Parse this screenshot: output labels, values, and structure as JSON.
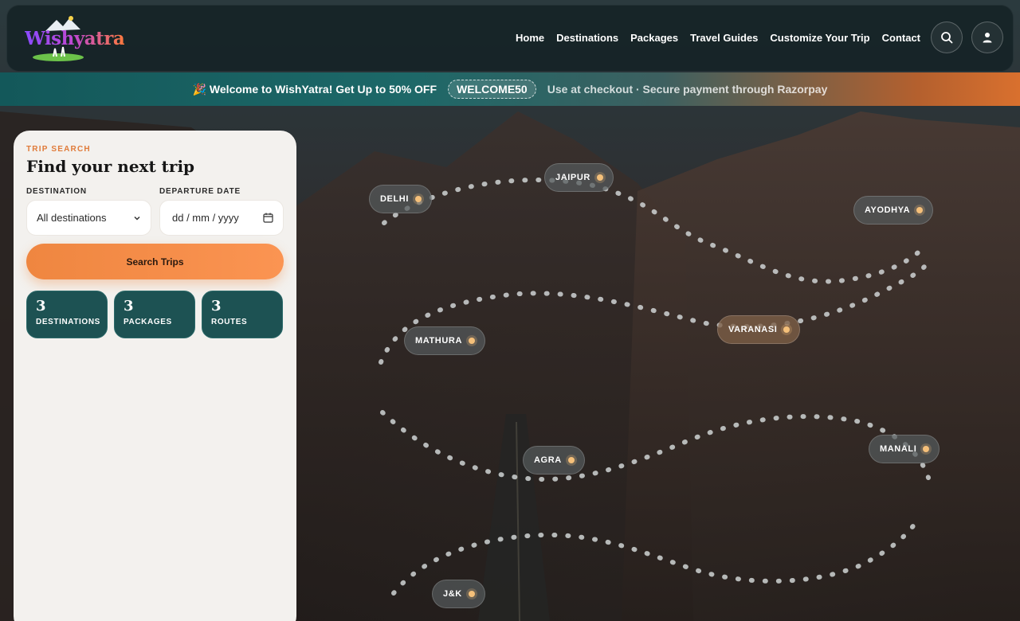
{
  "app": {
    "logo_text": "Wishyatra"
  },
  "nav": {
    "items": [
      "Home",
      "Destinations",
      "Packages",
      "Travel Guides",
      "Customize Your Trip",
      "Contact"
    ],
    "search_icon": "search-icon",
    "account_icon": "user-icon"
  },
  "promo": {
    "message": "🎉 Welcome to WishYatra! Get Up to 50% OFF",
    "code": "WELCOME50",
    "subtext": "Use at checkout · Secure payment through Razorpay"
  },
  "search_panel": {
    "kicker": "TRIP SEARCH",
    "title": "Find your next trip",
    "destination_label": "DESTINATION",
    "destination_value": "All destinations",
    "date_label": "DEPARTURE DATE",
    "date_placeholder": "dd / mm / yyyy",
    "button": "Search Trips",
    "stats": [
      {
        "value": "3",
        "label": "DESTINATIONS"
      },
      {
        "value": "3",
        "label": "PACKAGES"
      },
      {
        "value": "3",
        "label": "ROUTES"
      }
    ]
  },
  "map": {
    "pins": [
      "DELHI",
      "JAIPUR",
      "AYODHYA",
      "MATHURA",
      "VARANASI",
      "AGRA",
      "MANALI",
      "J&K"
    ],
    "active_pin": "VARANASI"
  },
  "colors": {
    "accent": "#ef8640",
    "teal": "#1d5253",
    "pin_dot": "#f5c07a"
  }
}
